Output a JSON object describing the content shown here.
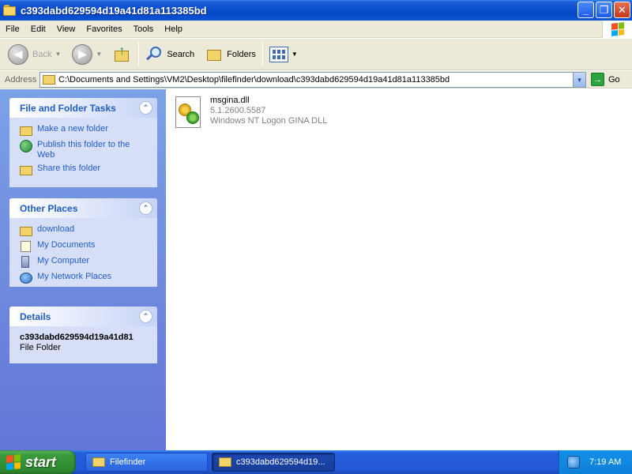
{
  "window": {
    "title": "c393dabd629594d19a41d81a113385bd",
    "controls": {
      "minimize": "_",
      "maximize": "❐",
      "close": "✕"
    }
  },
  "menubar": {
    "items": [
      "File",
      "Edit",
      "View",
      "Favorites",
      "Tools",
      "Help"
    ]
  },
  "toolbar": {
    "back_label": "Back",
    "search_label": "Search",
    "folders_label": "Folders"
  },
  "address": {
    "label": "Address",
    "value": "C:\\Documents and Settings\\VM2\\Desktop\\filefinder\\download\\c393dabd629594d19a41d81a113385bd",
    "go_label": "Go"
  },
  "sidebar": {
    "tasks": {
      "title": "File and Folder Tasks",
      "items": [
        {
          "label": "Make a new folder",
          "icon": "new-folder-icon"
        },
        {
          "label": "Publish this folder to the Web",
          "icon": "publish-web-icon"
        },
        {
          "label": "Share this folder",
          "icon": "share-folder-icon"
        }
      ]
    },
    "places": {
      "title": "Other Places",
      "items": [
        {
          "label": "download",
          "icon": "folder-icon"
        },
        {
          "label": "My Documents",
          "icon": "my-documents-icon"
        },
        {
          "label": "My Computer",
          "icon": "my-computer-icon"
        },
        {
          "label": "My Network Places",
          "icon": "network-places-icon"
        }
      ]
    },
    "details": {
      "title": "Details",
      "name": "c393dabd629594d19a41d81",
      "type": "File Folder"
    }
  },
  "files": [
    {
      "name": "msgina.dll",
      "version": "5.1.2600.5587",
      "description": "Windows NT Logon GINA DLL",
      "icon": "dll-file-icon"
    }
  ],
  "taskbar": {
    "start_label": "start",
    "tasks": [
      {
        "label": "Filefinder",
        "active": false
      },
      {
        "label": "c393dabd629594d19...",
        "active": true
      }
    ],
    "clock": "7:19 AM"
  },
  "colors": {
    "titlebar": "#0a4ed0",
    "sidebar_link": "#215dc6",
    "start_green": "#3a9a3a"
  }
}
